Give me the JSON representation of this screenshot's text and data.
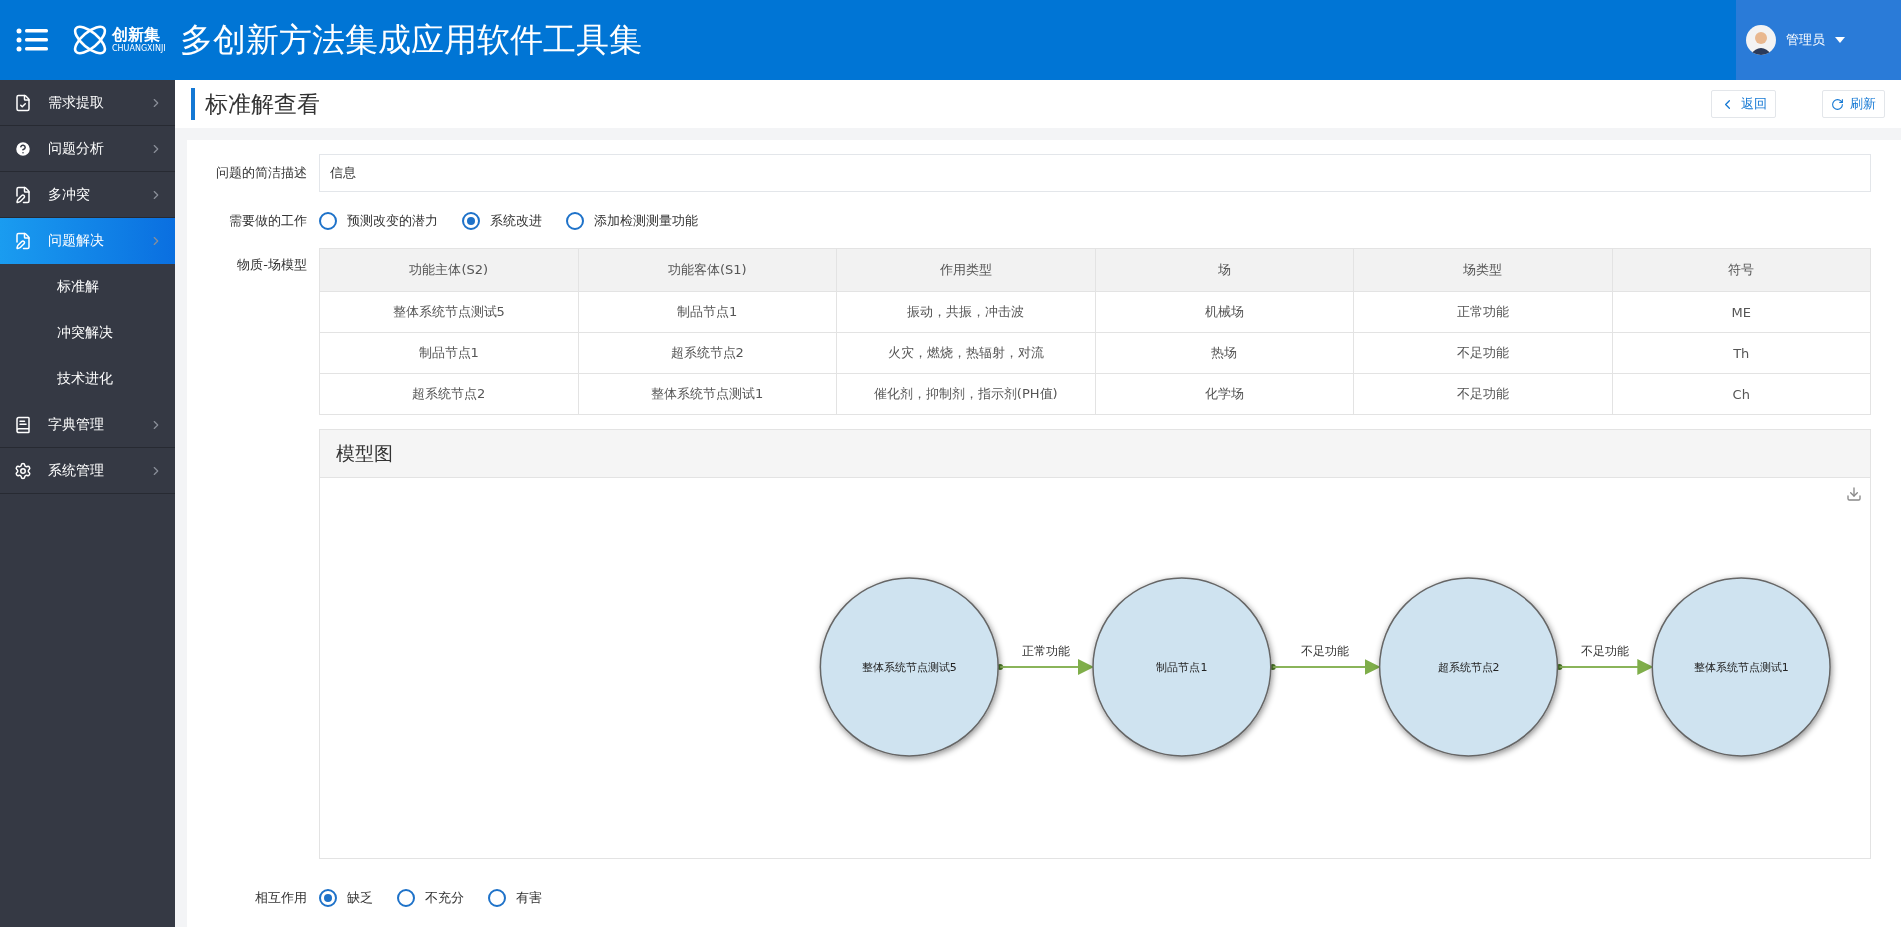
{
  "header": {
    "logo_text": "创新集",
    "logo_subtext": "CHUANGXINJI",
    "title": "多创新方法集成应用软件工具集",
    "user": "管理员"
  },
  "sidebar": {
    "items": [
      {
        "label": "需求提取",
        "selected": false
      },
      {
        "label": "问题分析",
        "selected": false
      },
      {
        "label": "多冲突",
        "selected": false
      },
      {
        "label": "问题解决",
        "selected": true,
        "children": [
          {
            "label": "标准解"
          },
          {
            "label": "冲突解决"
          },
          {
            "label": "技术进化"
          }
        ]
      },
      {
        "label": "字典管理",
        "selected": false
      },
      {
        "label": "系统管理",
        "selected": false
      }
    ]
  },
  "page": {
    "title": "标准解查看",
    "buttons": [
      {
        "kind": "back",
        "label": "返回"
      },
      {
        "kind": "refresh",
        "label": "刷新"
      }
    ]
  },
  "form": {
    "description": {
      "label": "问题的简洁描述",
      "value": "信息"
    },
    "work": {
      "label": "需要做的工作",
      "options": [
        {
          "label": "预测改变的潜力",
          "selected": false
        },
        {
          "label": "系统改进",
          "selected": true
        },
        {
          "label": "添加检测测量功能",
          "selected": false
        }
      ]
    },
    "model": {
      "label": "物质-场模型",
      "columns": [
        "功能主体(S2)",
        "功能客体(S1)",
        "作用类型",
        "场",
        "场类型",
        "符号"
      ],
      "rows": [
        [
          "整体系统节点测试5",
          "制品节点1",
          "振动，共振，冲击波",
          "机械场",
          "正常功能",
          "ME"
        ],
        [
          "制品节点1",
          "超系统节点2",
          "火灾，燃烧，热辐射，对流",
          "热场",
          "不足功能",
          "Th"
        ],
        [
          "超系统节点2",
          "整体系统节点测试1",
          "催化剂，抑制剂，指示剂(PH值)",
          "化学场",
          "不足功能",
          "Ch"
        ]
      ]
    },
    "diagram": {
      "title": "模型图",
      "nodes": [
        "整体系统节点测试5",
        "制品节点1",
        "超系统节点2",
        "整体系统节点测试1"
      ],
      "edges": [
        "正常功能",
        "不足功能",
        "不足功能"
      ]
    },
    "interaction": {
      "label": "相互作用",
      "options": [
        {
          "label": "缺乏",
          "selected": true
        },
        {
          "label": "不充分",
          "selected": false
        },
        {
          "label": "有害",
          "selected": false
        }
      ]
    }
  }
}
